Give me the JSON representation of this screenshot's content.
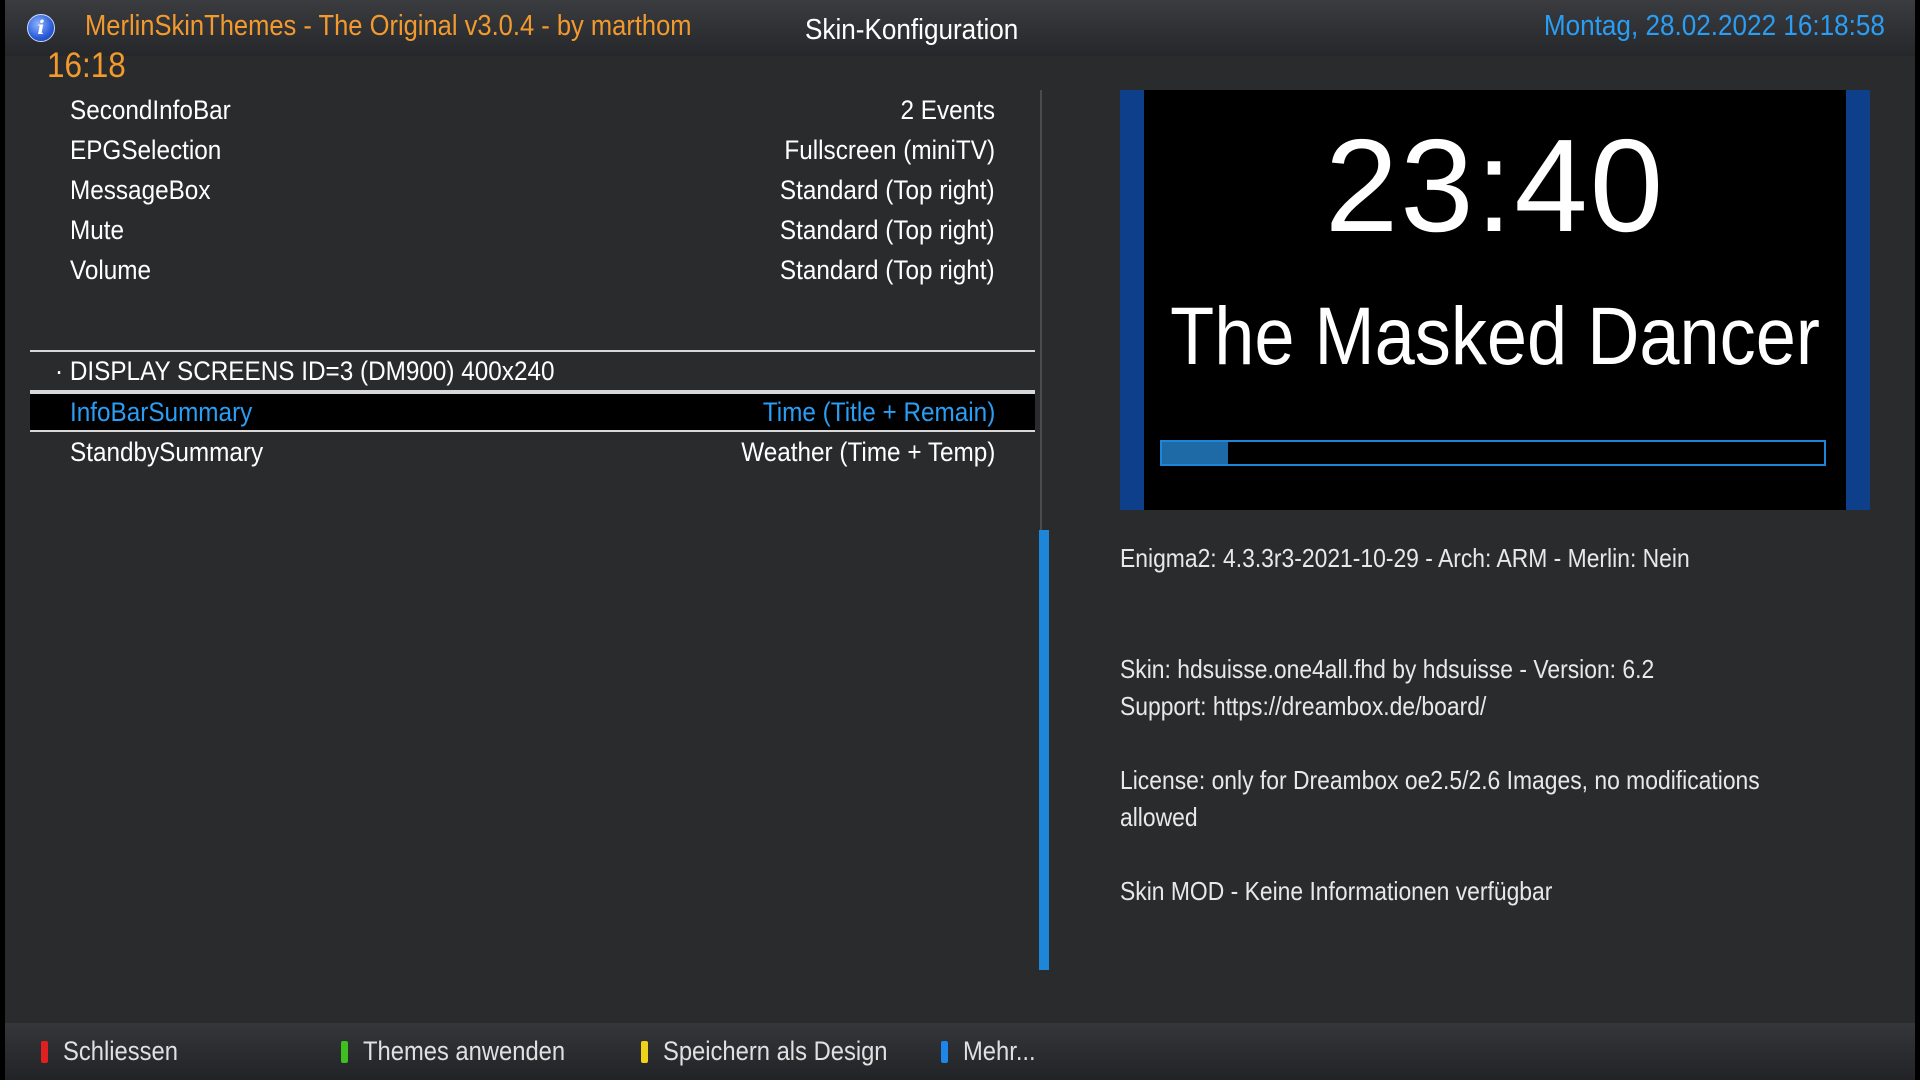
{
  "header": {
    "app_title": "MerlinSkinThemes - The Original  v3.0.4 - by marthom",
    "screen_title": "Skin-Konfiguration",
    "datetime": "Montag, 28.02.2022  16:18:58",
    "clock": "16:18"
  },
  "settings": {
    "rows_top": [
      {
        "label": "SecondInfoBar",
        "value": "2 Events"
      },
      {
        "label": "EPGSelection",
        "value": "Fullscreen (miniTV)"
      },
      {
        "label": "MessageBox",
        "value": "Standard (Top right)"
      },
      {
        "label": "Mute",
        "value": "Standard (Top right)"
      },
      {
        "label": "Volume",
        "value": "Standard (Top right)"
      }
    ],
    "section_label": "· DISPLAY SCREENS ID=3 (DM900) 400x240",
    "rows_bottom": [
      {
        "label": "InfoBarSummary",
        "value": "Time (Title + Remain)",
        "selected": true
      },
      {
        "label": "StandbySummary",
        "value": "Weather (Time + Temp)",
        "selected": false
      }
    ]
  },
  "preview": {
    "time": "23:40",
    "title": "The Masked Dancer",
    "progress_percent": 10
  },
  "info": {
    "enigma": "Enigma2: 4.3.3r3-2021-10-29 - Arch: ARM - Merlin: Nein",
    "skin": "Skin: hdsuisse.one4all.fhd by hdsuisse - Version: 6.2",
    "support": "Support: https://dreambox.de/board/",
    "license_line1": "License: only for Dreambox oe2.5/2.6 Images, no modifications",
    "license_line2": "allowed",
    "skin_mod": "Skin MOD - Keine Informationen verfügbar"
  },
  "footer": {
    "red": {
      "label": "Schliessen",
      "color": "#e02020"
    },
    "green": {
      "label": "Themes anwenden",
      "color": "#3ec01e"
    },
    "yellow": {
      "label": "Speichern als Design",
      "color": "#f0d21a"
    },
    "blue": {
      "label": "Mehr...",
      "color": "#1e86e8"
    }
  }
}
